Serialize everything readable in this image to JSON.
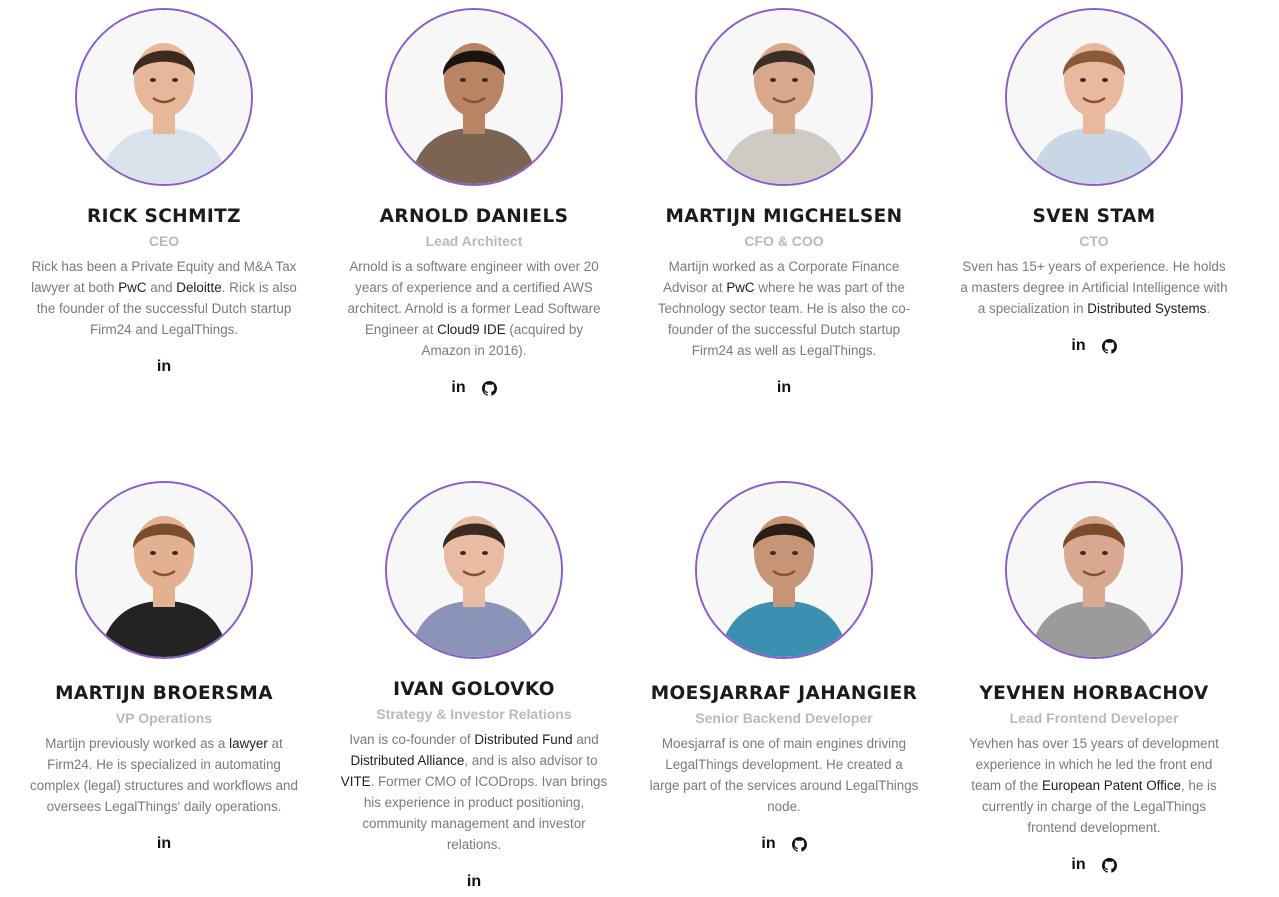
{
  "icons": {
    "linkedin": "in",
    "github": "github-icon"
  },
  "colors": {
    "avatar_border": "#8a5cc9",
    "role": "#b9b9b9",
    "text": "#7a7a7a"
  },
  "members": [
    {
      "name": "RICK SCHMITZ",
      "role": "CEO",
      "bio": [
        {
          "t": "Rick has been a Private Equity and M&A Tax lawyer at both "
        },
        {
          "t": "PwC",
          "link": true
        },
        {
          "t": " and "
        },
        {
          "t": "Deloitte",
          "link": true
        },
        {
          "t": ". Rick is also the founder of the successful Dutch startup Firm24 and LegalThings."
        }
      ],
      "social": [
        "linkedin"
      ],
      "photo": {
        "skin": "#e7b79a",
        "hair": "#3d2a1e",
        "shirt": "#d9e1ea"
      }
    },
    {
      "name": "ARNOLD DANIELS",
      "role": "Lead Architect",
      "bio": [
        {
          "t": "Arnold is a software engineer with over 20 years of experience and a certified AWS architect. Arnold is a former Lead Software Engineer at "
        },
        {
          "t": "Cloud9 IDE",
          "link": true
        },
        {
          "t": " (acquired by Amazon in 2016)."
        }
      ],
      "social": [
        "linkedin",
        "github"
      ],
      "photo": {
        "skin": "#b98463",
        "hair": "#1b130f",
        "shirt": "#7b6552"
      }
    },
    {
      "name": "MARTIJN MIGCHELSEN",
      "role": "CFO & COO",
      "bio": [
        {
          "t": "Martijn worked as a Corporate Finance Advisor at "
        },
        {
          "t": "PwC",
          "link": true
        },
        {
          "t": " where he was part of the Technology sector team. He is also the co-founder of the successful Dutch startup Firm24 as well as LegalThings."
        }
      ],
      "social": [
        "linkedin"
      ],
      "photo": {
        "skin": "#d9a88c",
        "hair": "#3a2e26",
        "shirt": "#cfcac4"
      }
    },
    {
      "name": "SVEN STAM",
      "role": "CTO",
      "bio": [
        {
          "t": "Sven has 15+ years of experience. He holds a masters degree in Artificial Intelligence with a specialization in "
        },
        {
          "t": "Distributed Systems",
          "link": true
        },
        {
          "t": "."
        }
      ],
      "social": [
        "linkedin",
        "github"
      ],
      "photo": {
        "skin": "#eab89f",
        "hair": "#8a5a38",
        "shirt": "#c9d6e6"
      }
    },
    {
      "name": "MARTIJN BROERSMA",
      "role": "VP Operations",
      "bio": [
        {
          "t": "Martijn previously worked as a "
        },
        {
          "t": "lawyer",
          "link": true
        },
        {
          "t": " at Firm24. He is specialized in automating complex (legal) structures and workflows and oversees LegalThings' daily operations."
        }
      ],
      "social": [
        "linkedin"
      ],
      "photo": {
        "skin": "#e3b092",
        "hair": "#7a4e2c",
        "shirt": "#232323"
      }
    },
    {
      "name": "IVAN GOLOVKO",
      "role": "Strategy & Investor Relations",
      "bio": [
        {
          "t": "Ivan is co-founder of "
        },
        {
          "t": "Distributed Fund",
          "link": true
        },
        {
          "t": " and "
        },
        {
          "t": "Distributed Alliance",
          "link": true
        },
        {
          "t": ", and is also advisor to "
        },
        {
          "t": "VITE",
          "link": true
        },
        {
          "t": ". Former CMO of ICODrops. Ivan brings his experience in product positioning, community management and investor relations."
        }
      ],
      "social": [
        "linkedin"
      ],
      "photo": {
        "skin": "#e8bba2",
        "hair": "#3b2a20",
        "shirt": "#8b93b8"
      }
    },
    {
      "name": "MOESJARRAF JAHANGIER",
      "role": "Senior Backend Developer",
      "bio": [
        {
          "t": "Moesjarraf is one of main engines driving LegalThings development. He created a large part of the services around LegalThings node."
        }
      ],
      "social": [
        "linkedin",
        "github"
      ],
      "photo": {
        "skin": "#c79576",
        "hair": "#2a1d16",
        "shirt": "#3b8fb0"
      }
    },
    {
      "name": "YEVHEN HORBACHOV",
      "role": "Lead Frontend Developer",
      "bio": [
        {
          "t": "Yevhen has over 15 years of development experience in which he led the front end team of the "
        },
        {
          "t": "European Patent Office",
          "link": true
        },
        {
          "t": ", he is currently in charge of the LegalThings frontend development."
        }
      ],
      "social": [
        "linkedin",
        "github"
      ],
      "photo": {
        "skin": "#d9a890",
        "hair": "#7a4a2a",
        "shirt": "#9b9b9b"
      }
    }
  ]
}
